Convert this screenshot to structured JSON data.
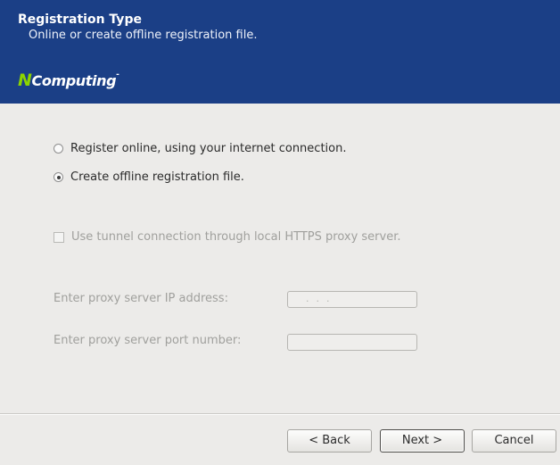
{
  "header": {
    "title": "Registration Type",
    "subtitle": "Online or create offline registration file.",
    "logo_n": "N",
    "logo_text": "Computing",
    "logo_tm": "-"
  },
  "options": {
    "online_label": "Register online, using your internet connection.",
    "offline_label": "Create offline registration file.",
    "selected": "offline"
  },
  "proxy": {
    "tunnel_label": "Use tunnel connection through local HTTPS proxy server.",
    "tunnel_checked": false,
    "ip_label": "Enter proxy server IP address:",
    "ip_value": "...",
    "port_label": "Enter proxy server port number:",
    "port_value": ""
  },
  "buttons": {
    "back": "< Back",
    "next": "Next >",
    "cancel": "Cancel"
  },
  "colors": {
    "header_bg": "#1b3f86",
    "logo_accent": "#8cd400",
    "window_bg": "#ecebe9",
    "disabled_text": "#a0a09d"
  }
}
